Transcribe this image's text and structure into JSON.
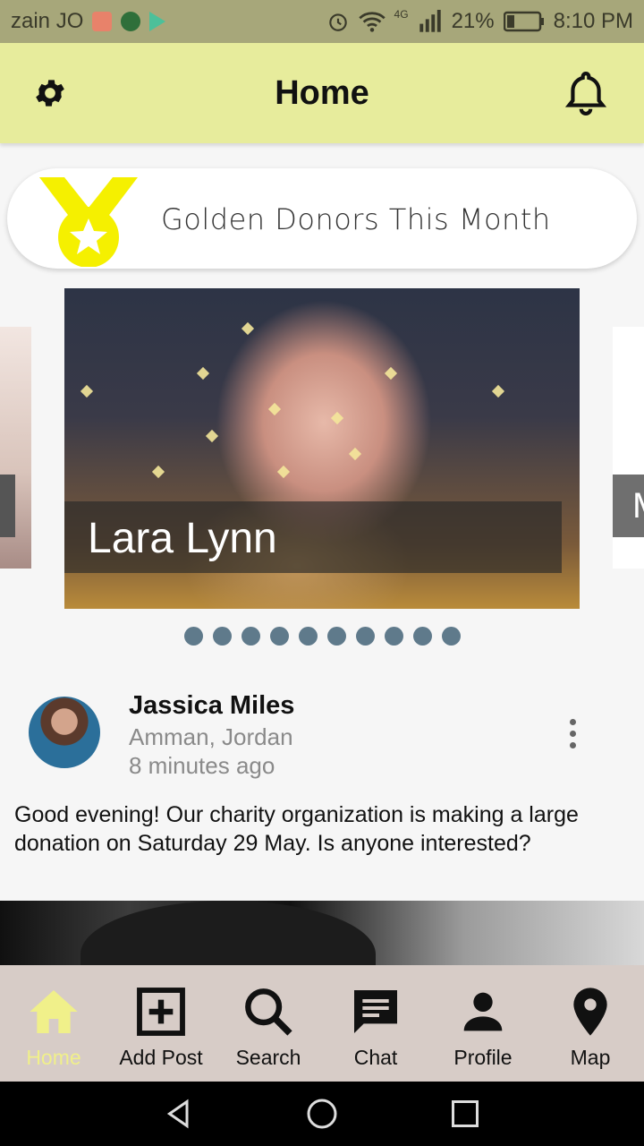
{
  "status_bar": {
    "carrier": "zain JO",
    "network": "4G",
    "battery": "21%",
    "time": "8:10 PM"
  },
  "app_bar": {
    "title": "Home"
  },
  "golden_donors": {
    "label": "Golden Donors This Month"
  },
  "carousel": {
    "current_name": "Lara Lynn",
    "next_name_partial": "M",
    "dot_count": 10
  },
  "post": {
    "author": "Jassica Miles",
    "location": "Amman, Jordan",
    "time_ago": "8 minutes ago",
    "text": "Good evening! Our charity organization is making a large donation on Saturday 29 May. Is anyone interested?"
  },
  "bottom_nav": {
    "items": [
      {
        "label": "Home",
        "icon": "home-icon",
        "active": true
      },
      {
        "label": "Add Post",
        "icon": "add-box-icon",
        "active": false
      },
      {
        "label": "Search",
        "icon": "search-icon",
        "active": false
      },
      {
        "label": "Chat",
        "icon": "chat-icon",
        "active": false
      },
      {
        "label": "Profile",
        "icon": "person-icon",
        "active": false
      },
      {
        "label": "Map",
        "icon": "map-pin-icon",
        "active": false
      }
    ]
  },
  "colors": {
    "app_bar": "#e7ec9c",
    "status_bar": "#a7a77a",
    "active_nav": "#f0f08a",
    "medal": "#f5f000",
    "dots": "#5f7a8b",
    "bottom_nav": "#d7ccc7"
  }
}
